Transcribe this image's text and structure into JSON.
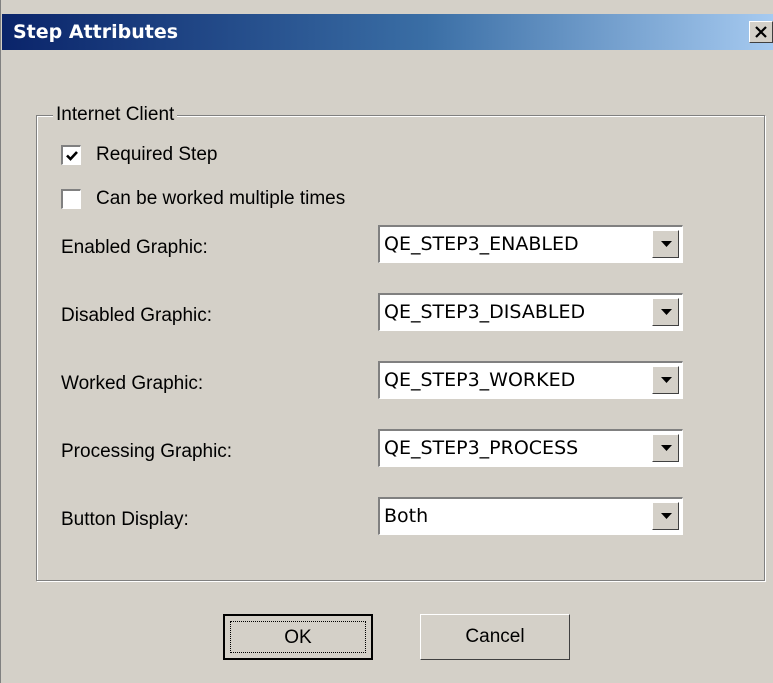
{
  "window": {
    "title": "Step Attributes",
    "close_icon": "close-icon"
  },
  "group": {
    "legend": "Internet Client"
  },
  "checkboxes": [
    {
      "label": "Required Step",
      "checked": true
    },
    {
      "label": "Can be worked multiple times",
      "checked": false
    }
  ],
  "fields": [
    {
      "label": "Enabled Graphic:",
      "value": "QE_STEP3_ENABLED"
    },
    {
      "label": "Disabled Graphic:",
      "value": "QE_STEP3_DISABLED"
    },
    {
      "label": "Worked Graphic:",
      "value": "QE_STEP3_WORKED"
    },
    {
      "label": "Processing Graphic:",
      "value": "QE_STEP3_PROCESS"
    },
    {
      "label": "Button Display:",
      "value": "Both"
    }
  ],
  "buttons": {
    "ok": "OK",
    "cancel": "Cancel"
  },
  "colors": {
    "face": "#d4d0c8",
    "title_start": "#0a246a",
    "title_end": "#a6caf0"
  }
}
